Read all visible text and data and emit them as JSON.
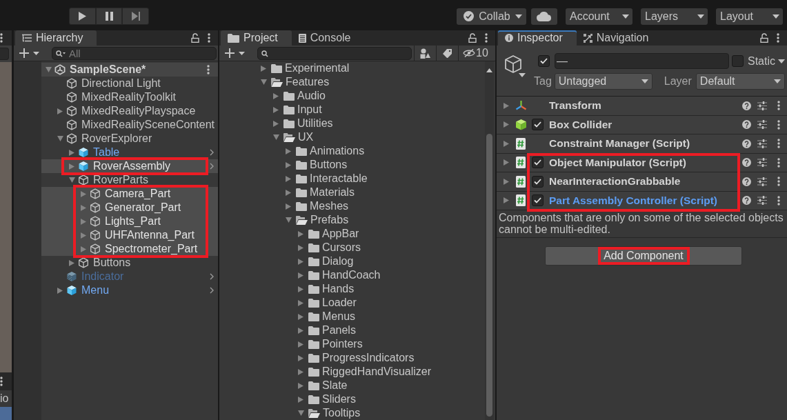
{
  "toolbar": {
    "play_controls": [
      {
        "kind": "play"
      },
      {
        "kind": "pause"
      },
      {
        "kind": "step"
      }
    ],
    "buttons": [
      {
        "kind": "collab",
        "label": "Collab"
      },
      {
        "kind": "cloud"
      },
      {
        "kind": "dropdown",
        "label": "Account"
      },
      {
        "kind": "dropdown",
        "label": "Layers"
      },
      {
        "kind": "dropdown",
        "label": "Layout"
      }
    ]
  },
  "side_panel": {
    "list_text": "io"
  },
  "hierarchy": {
    "focused": false,
    "tabs": [
      {
        "label": "Hierarchy",
        "kind": "hierarchy",
        "selected": true
      }
    ],
    "search": {
      "placeholder": "All"
    },
    "tree": [
      {
        "name": "SampleScene*",
        "kind": "scene",
        "expanded": true,
        "selected": false,
        "disabled": false,
        "children": [
          {
            "name": "Directional Light",
            "kind": "object",
            "selected": false,
            "disabled": false
          },
          {
            "name": "MixedRealityToolkit",
            "kind": "object",
            "selected": false,
            "disabled": false
          },
          {
            "name": "MixedRealityPlayspace",
            "kind": "object",
            "expanded": false,
            "selected": false,
            "disabled": false
          },
          {
            "name": "MixedRealitySceneContent",
            "kind": "object",
            "selected": false,
            "disabled": false
          },
          {
            "name": "RoverExplorer",
            "kind": "object",
            "expanded": true,
            "selected": false,
            "disabled": false,
            "children": [
              {
                "name": "Table",
                "kind": "prefab",
                "expanded": false,
                "selected": false,
                "disabled": false
              },
              {
                "kind": "annotation_box",
                "items": [
                  {
                    "name": "RoverAssembly",
                    "kind": "prefab",
                    "expanded": false,
                    "selected": true,
                    "disabled": false
                  }
                ]
              },
              {
                "name": "RoverParts",
                "kind": "object",
                "expanded": true,
                "selected": false,
                "disabled": false,
                "children": [
                  {
                    "kind": "annotation_box",
                    "items": [
                      {
                        "name": "Camera_Part",
                        "kind": "object",
                        "expanded": false,
                        "selected": true,
                        "disabled": false
                      },
                      {
                        "name": "Generator_Part",
                        "kind": "object",
                        "expanded": false,
                        "selected": true,
                        "disabled": false
                      },
                      {
                        "name": "Lights_Part",
                        "kind": "object",
                        "expanded": false,
                        "selected": true,
                        "disabled": false
                      },
                      {
                        "name": "UHFAntenna_Part",
                        "kind": "object",
                        "expanded": false,
                        "selected": true,
                        "disabled": false
                      },
                      {
                        "name": "Spectrometer_Part",
                        "kind": "object",
                        "expanded": false,
                        "selected": true,
                        "disabled": false
                      }
                    ]
                  }
                ]
              },
              {
                "name": "Buttons",
                "kind": "object",
                "expanded": false,
                "selected": false,
                "disabled": false
              }
            ]
          },
          {
            "name": "Indicator",
            "kind": "prefab",
            "selected": false,
            "disabled": true
          },
          {
            "name": "Menu",
            "kind": "prefab",
            "expanded": false,
            "selected": false,
            "disabled": false
          }
        ]
      }
    ]
  },
  "project": {
    "focused": false,
    "tabs": [
      {
        "label": "Project",
        "kind": "project",
        "selected": true
      },
      {
        "label": "Console",
        "kind": "console",
        "selected": false
      }
    ],
    "hidden_count": "10",
    "tree": [
      {
        "name": "Experimental",
        "expanded": false
      },
      {
        "name": "Features",
        "expanded": true,
        "children": [
          {
            "name": "Audio",
            "expanded": false
          },
          {
            "name": "Input",
            "expanded": false
          },
          {
            "name": "Utilities",
            "expanded": false
          },
          {
            "name": "UX",
            "expanded": true,
            "children": [
              {
                "name": "Animations",
                "expanded": false
              },
              {
                "name": "Buttons",
                "expanded": false
              },
              {
                "name": "Interactable",
                "expanded": false
              },
              {
                "name": "Materials",
                "expanded": false
              },
              {
                "name": "Meshes",
                "expanded": false
              },
              {
                "name": "Prefabs",
                "expanded": true,
                "children": [
                  {
                    "name": "AppBar",
                    "expanded": false
                  },
                  {
                    "name": "Cursors",
                    "expanded": false
                  },
                  {
                    "name": "Dialog",
                    "expanded": false
                  },
                  {
                    "name": "HandCoach",
                    "expanded": false
                  },
                  {
                    "name": "Hands",
                    "expanded": false
                  },
                  {
                    "name": "Loader",
                    "expanded": false
                  },
                  {
                    "name": "Menus",
                    "expanded": false
                  },
                  {
                    "name": "Panels",
                    "expanded": false
                  },
                  {
                    "name": "Pointers",
                    "expanded": false
                  },
                  {
                    "name": "ProgressIndicators",
                    "expanded": false
                  },
                  {
                    "name": "RiggedHandVisualizer",
                    "expanded": false
                  },
                  {
                    "name": "Slate",
                    "expanded": false
                  },
                  {
                    "name": "Sliders",
                    "expanded": false
                  },
                  {
                    "name": "Tooltips",
                    "expanded": true
                  }
                ]
              }
            ]
          }
        ]
      }
    ]
  },
  "inspector": {
    "focused": true,
    "tabs": [
      {
        "label": "Inspector",
        "kind": "inspector",
        "selected": true
      },
      {
        "label": "Navigation",
        "kind": "navigation",
        "selected": false
      }
    ],
    "object": {
      "active": true,
      "name": "—",
      "static": false,
      "static_label": "Static",
      "tag_label": "Tag",
      "tag": "Untagged",
      "layer_label": "Layer",
      "layer": "Default"
    },
    "components": [
      {
        "name": "Transform",
        "kind": "transform",
        "override": false
      },
      {
        "name": "Box Collider",
        "kind": "collider",
        "checked": true,
        "override": false
      },
      {
        "name": "Constraint Manager (Script)",
        "kind": "script",
        "override": false
      },
      {
        "kind": "annotation_box",
        "items": [
          {
            "name": "Object Manipulator (Script)",
            "kind": "script",
            "checked": true,
            "override": false
          },
          {
            "name": "NearInteractionGrabbable",
            "kind": "script",
            "checked": true,
            "override": false
          },
          {
            "name": "Part Assembly Controller (Script)",
            "kind": "script",
            "checked": true,
            "override": true
          }
        ]
      }
    ],
    "notice": "Components that are only on some of the selected objects cannot be multi-edited.",
    "add_button": {
      "label": "Add Component",
      "annotated": true
    }
  }
}
